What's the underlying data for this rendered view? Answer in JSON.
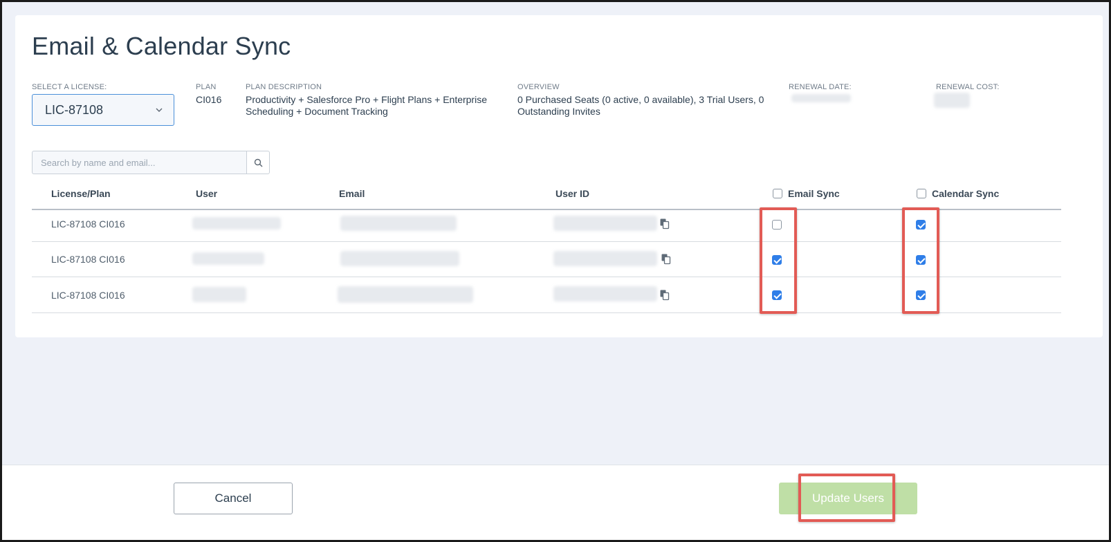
{
  "title": "Email & Calendar Sync",
  "license": {
    "label": "SELECT A LICENSE:",
    "selected": "LIC-87108"
  },
  "plan": {
    "label": "PLAN",
    "value": "CI016"
  },
  "plan_description": {
    "label": "PLAN DESCRIPTION",
    "value": "Productivity + Salesforce Pro + Flight Plans + Enterprise Scheduling + Document Tracking"
  },
  "overview": {
    "label": "OVERVIEW",
    "value": "0 Purchased Seats (0 active, 0 available), 3 Trial Users, 0 Outstanding Invites"
  },
  "renewal_date": {
    "label": "RENEWAL DATE:"
  },
  "renewal_cost": {
    "label": "RENEWAL COST:"
  },
  "search": {
    "placeholder": "Search by name and email...",
    "icon": "search-icon"
  },
  "table": {
    "headers": {
      "license_plan": "License/Plan",
      "user": "User",
      "email": "Email",
      "user_id": "User ID",
      "email_sync": "Email Sync",
      "calendar_sync": "Calendar Sync"
    },
    "header_checks": {
      "email_sync": false,
      "calendar_sync": false
    },
    "rows": [
      {
        "license_plan": "LIC-87108 CI016",
        "email_sync": false,
        "calendar_sync": true
      },
      {
        "license_plan": "LIC-87108 CI016",
        "email_sync": true,
        "calendar_sync": true
      },
      {
        "license_plan": "LIC-87108 CI016",
        "email_sync": true,
        "calendar_sync": true
      }
    ]
  },
  "footer": {
    "cancel_label": "Cancel",
    "update_label": "Update Users"
  },
  "colors": {
    "accent": "#2f7ee8",
    "highlight": "#e25b55",
    "update_button": "#bfdfa6"
  }
}
